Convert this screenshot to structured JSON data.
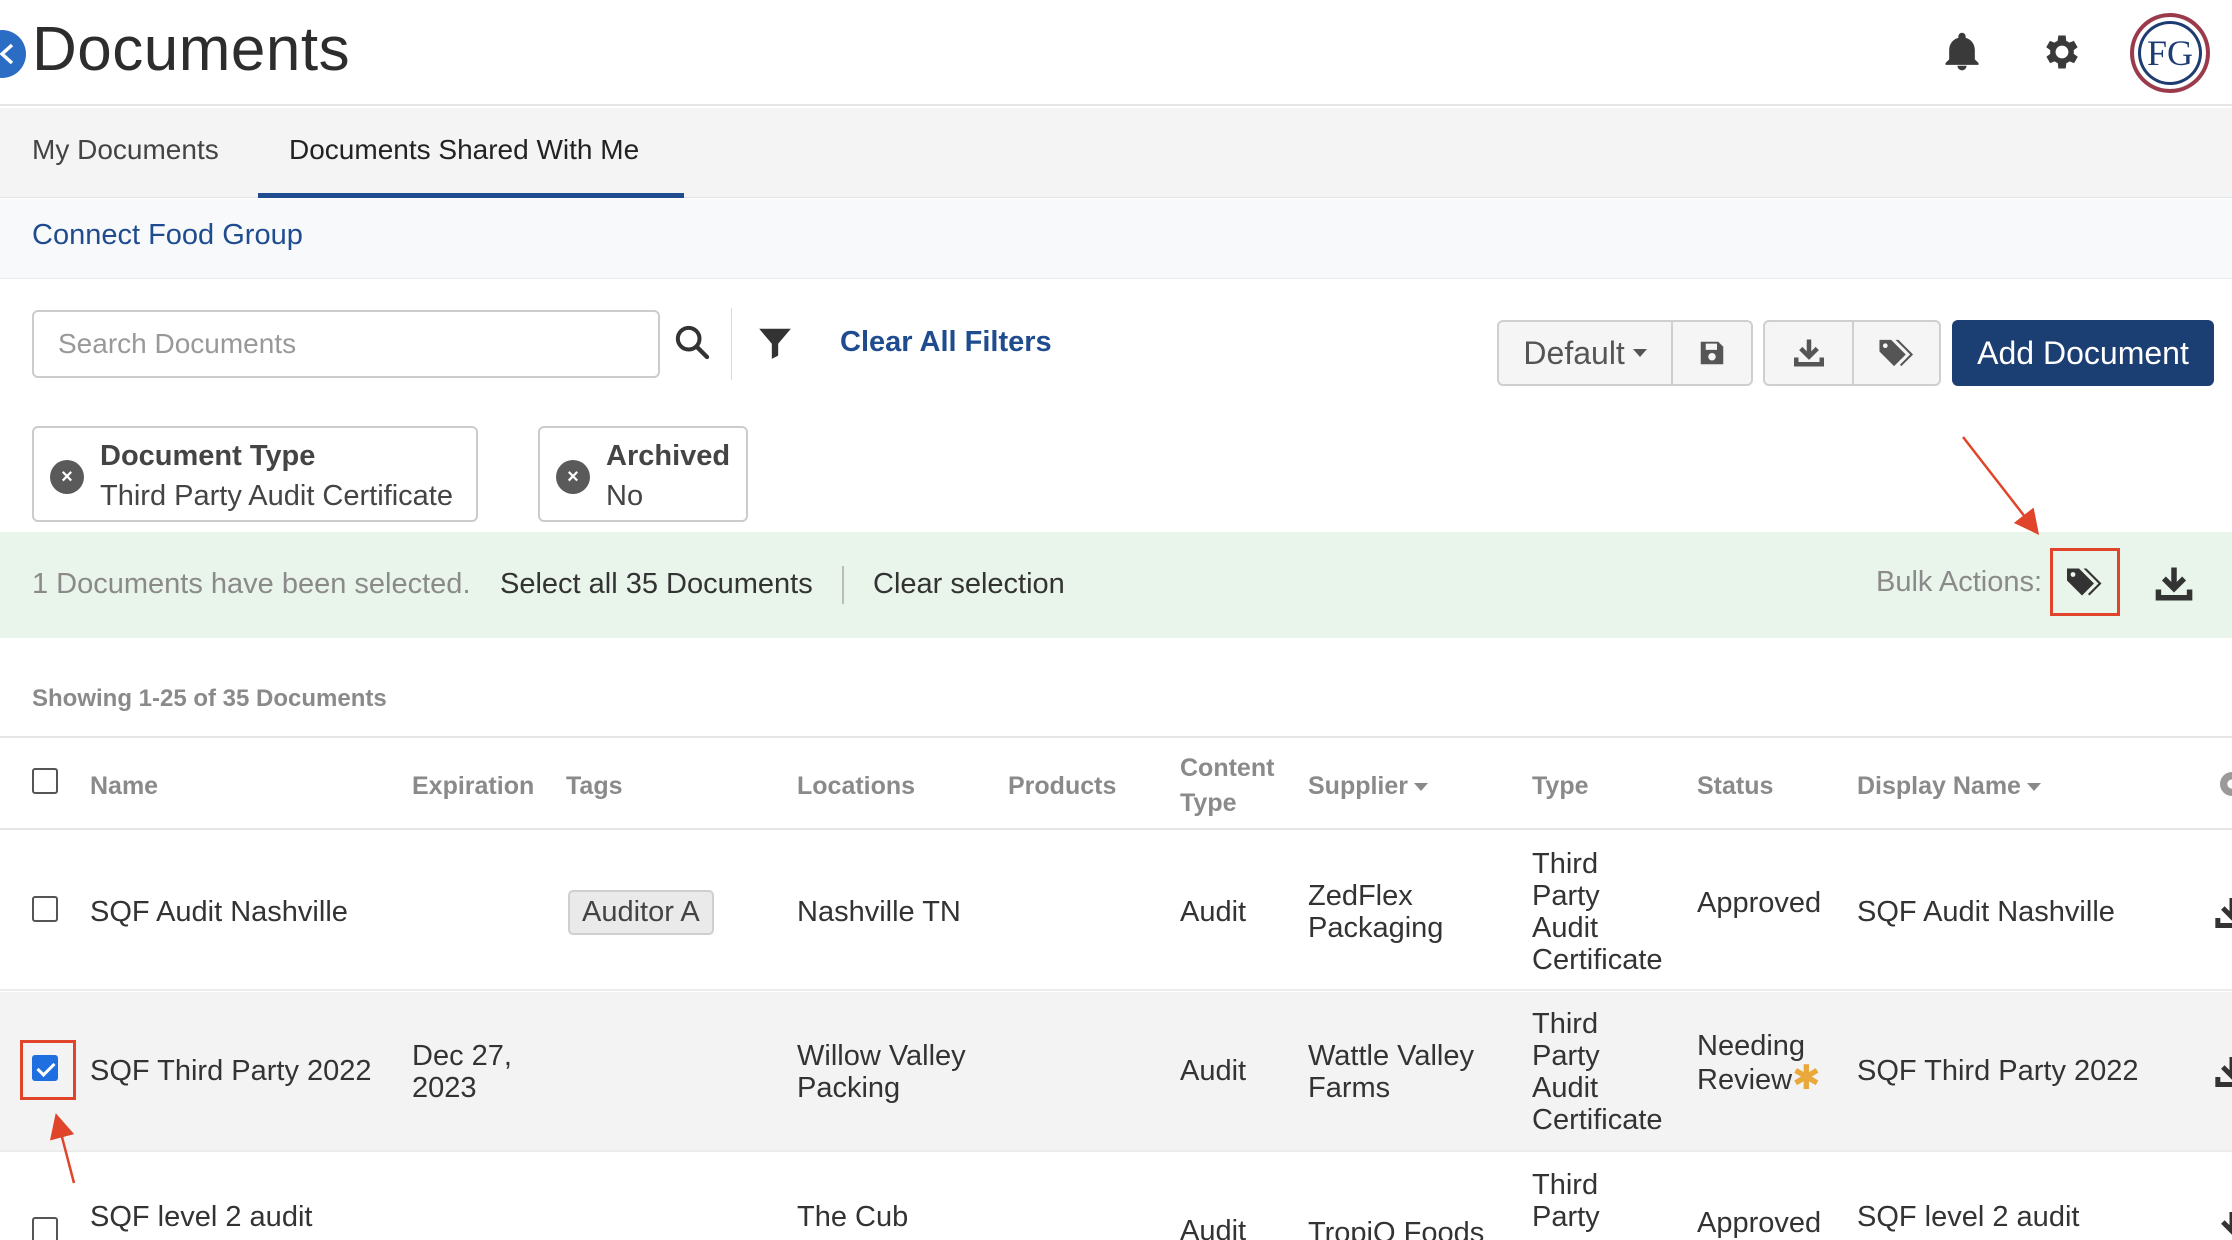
{
  "header": {
    "title": "Documents",
    "avatar_text": "FG"
  },
  "tabs": [
    {
      "label": "My Documents",
      "active": false
    },
    {
      "label": "Documents Shared With Me",
      "active": true
    }
  ],
  "org": {
    "name": "Connect Food Group"
  },
  "toolbar": {
    "search_placeholder": "Search Documents",
    "clear_filters": "Clear All Filters",
    "view_select": "Default",
    "add_document": "Add Document"
  },
  "filters": [
    {
      "title": "Document Type",
      "value": "Third Party Audit Certificate"
    },
    {
      "title": "Archived",
      "value": "No"
    }
  ],
  "bulk": {
    "selected_text": "1 Documents have been selected.",
    "select_all": "Select all 35 Documents",
    "clear_selection": "Clear selection",
    "label": "Bulk Actions:"
  },
  "showing": "Showing 1-25 of 35 Documents",
  "table": {
    "headers": {
      "name": "Name",
      "expiration": "Expiration",
      "tags": "Tags",
      "locations": "Locations",
      "products": "Products",
      "content_type_1": "Content",
      "content_type_2": "Type",
      "supplier": "Supplier",
      "type": "Type",
      "status": "Status",
      "display_name": "Display Name"
    },
    "rows": [
      {
        "checked": false,
        "name": "SQF Audit Nashville",
        "expiration_1": "",
        "expiration_2": "",
        "tag": "Auditor A",
        "location_1": "Nashville TN",
        "location_2": "",
        "content_type": "Audit",
        "supplier_1": "ZedFlex",
        "supplier_2": "Packaging",
        "type_1": "Third",
        "type_2": "Party",
        "type_3": "Audit",
        "type_4": "Certificate",
        "status_1": "Approved",
        "status_2": "",
        "display_name": "SQF Audit Nashville"
      },
      {
        "checked": true,
        "name": "SQF Third Party 2022",
        "expiration_1": "Dec 27,",
        "expiration_2": "2023",
        "tag": "",
        "location_1": "Willow Valley",
        "location_2": "Packing",
        "content_type": "Audit",
        "supplier_1": "Wattle Valley",
        "supplier_2": "Farms",
        "type_1": "Third",
        "type_2": "Party",
        "type_3": "Audit",
        "type_4": "Certificate",
        "status_1": "Needing",
        "status_2": "Review",
        "status_star": "✱",
        "display_name": "SQF Third Party 2022"
      },
      {
        "checked": false,
        "name": "SQF level 2 audit",
        "location_1": "The Cub",
        "content_type": "Audit",
        "supplier_1": "TropiQ Foods",
        "type_1": "Third",
        "type_2": "Party",
        "status_1": "Approved",
        "display_name": "SQF level 2 audit"
      }
    ]
  },
  "colors": {
    "brand_navy": "#1c3f73",
    "link_blue": "#1f4c8f",
    "bulk_bg": "#e9f4ea",
    "highlight_red": "#e0452b",
    "checkbox_blue": "#1f6fe0",
    "review_star": "#e9a83a"
  }
}
